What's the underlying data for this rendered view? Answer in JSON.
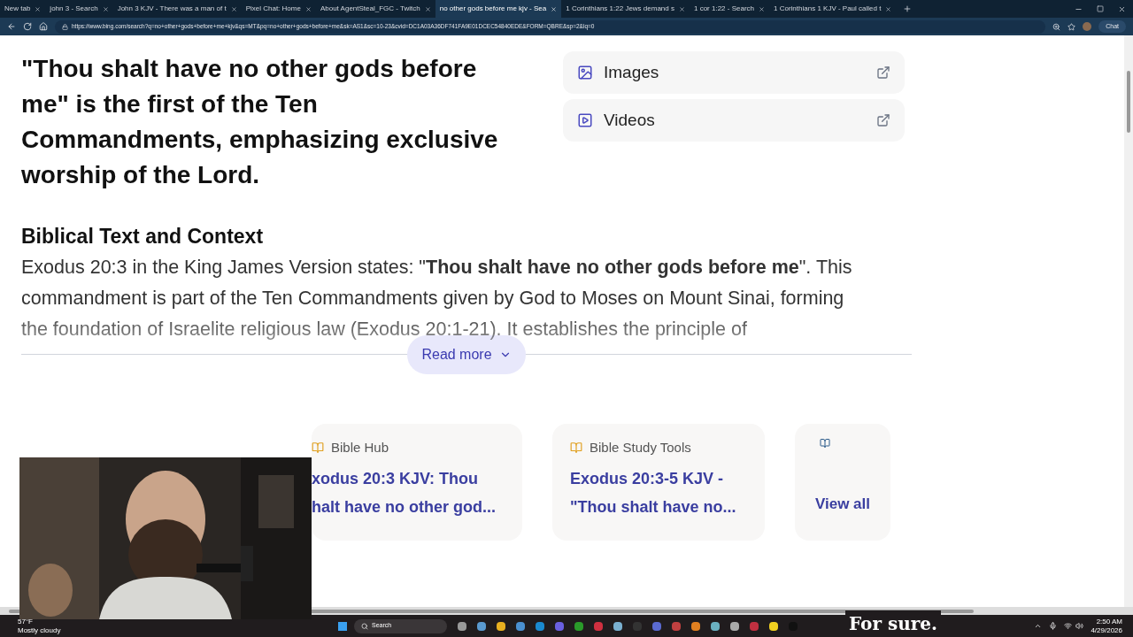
{
  "tabs": [
    {
      "title": "New tab",
      "selected": false
    },
    {
      "title": "john 3 - Search",
      "selected": false
    },
    {
      "title": "John 3 KJV - There was a man of t",
      "selected": false
    },
    {
      "title": "Pixel Chat: Home",
      "selected": false
    },
    {
      "title": "About AgentSteal_FGC - Twitch",
      "selected": false
    },
    {
      "title": "no other gods before me kjv - Sea",
      "selected": true
    },
    {
      "title": "1 Corinthians 1:22 Jews demand s",
      "selected": false
    },
    {
      "title": "1 cor 1:22 - Search",
      "selected": false
    },
    {
      "title": "1 Corinthians 1 KJV - Paul called t",
      "selected": false
    }
  ],
  "address_bar": {
    "url": "https://www.bing.com/search?q=no+other+gods+before+me+kjv&qs=MT&pq=no+other+gods+before+me&sk=AS1&sc=10-23&cvid=DC1A03A36DF741FA9E01DCEC54840EDE&FORM=QBRE&sp=2&lq=0",
    "chat": "Chat"
  },
  "answer": {
    "headline": "\"Thou shalt have no other gods before me\" is the first of the Ten Commandments, emphasizing exclusive worship of the Lord.",
    "section_title": "Biblical Text and Context",
    "paragraph": "Exodus 20:3 in the King James Version states: \"**Thou shalt have no other gods before me**\". This commandment is part of the Ten Commandments given by God to Moses on Mount Sinai, forming the foundation of Israelite religious law (Exodus 20:1-21). It establishes the principle of",
    "read_more": "Read more"
  },
  "side_links": [
    {
      "label": "Images",
      "kind": "images"
    },
    {
      "label": "Videos",
      "kind": "videos"
    }
  ],
  "sources": [
    {
      "kind": "source",
      "site": "Bible Hub",
      "title": "xodus 20:3 KJV: Thou halt have no other god..."
    },
    {
      "kind": "source",
      "site": "Bible Study Tools",
      "title": "Exodus 20:3-5 KJV - \"Thou shalt have no..."
    },
    {
      "kind": "view_all",
      "title": "View all"
    }
  ],
  "taskbar": {
    "weather_temp": "57°F",
    "weather_text": "Mostly cloudy",
    "search": "Search",
    "time": "2:50 AM",
    "date": "4/29/2026"
  },
  "caption": "For sure."
}
